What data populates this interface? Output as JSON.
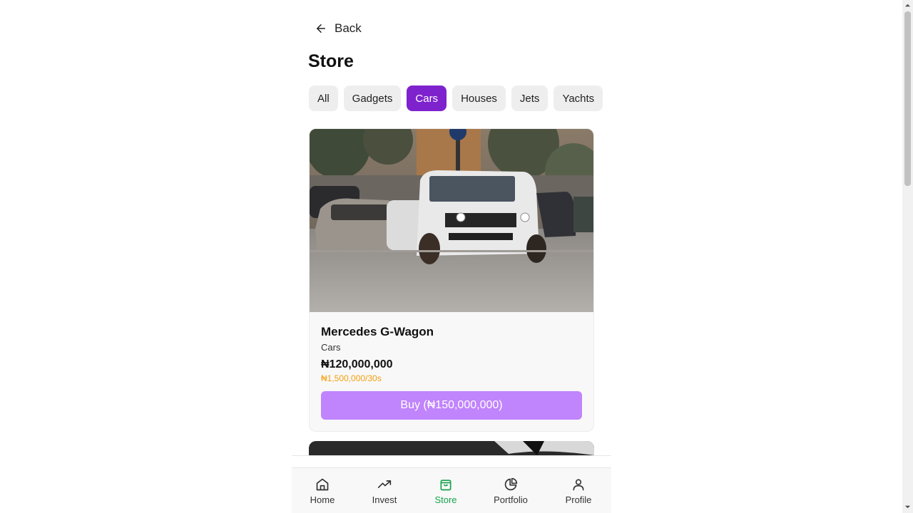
{
  "header": {
    "back_label": "Back",
    "title": "Store"
  },
  "filters": [
    {
      "label": "All",
      "active": false
    },
    {
      "label": "Gadgets",
      "active": false
    },
    {
      "label": "Cars",
      "active": true
    },
    {
      "label": "Houses",
      "active": false
    },
    {
      "label": "Jets",
      "active": false
    },
    {
      "label": "Yachts",
      "active": false
    }
  ],
  "product": {
    "name": "Mercedes G-Wagon",
    "category": "Cars",
    "price": "₦120,000,000",
    "rate": "₦1,500,000/30s",
    "buy_label": "Buy (₦150,000,000)"
  },
  "nav": {
    "home": "Home",
    "invest": "Invest",
    "store": "Store",
    "portfolio": "Portfolio",
    "profile": "Profile",
    "active": "store"
  },
  "colors": {
    "accent": "#7e22ce",
    "buy_button": "#c084fc",
    "rate_text": "#f59e0b",
    "nav_active": "#16a34a"
  }
}
